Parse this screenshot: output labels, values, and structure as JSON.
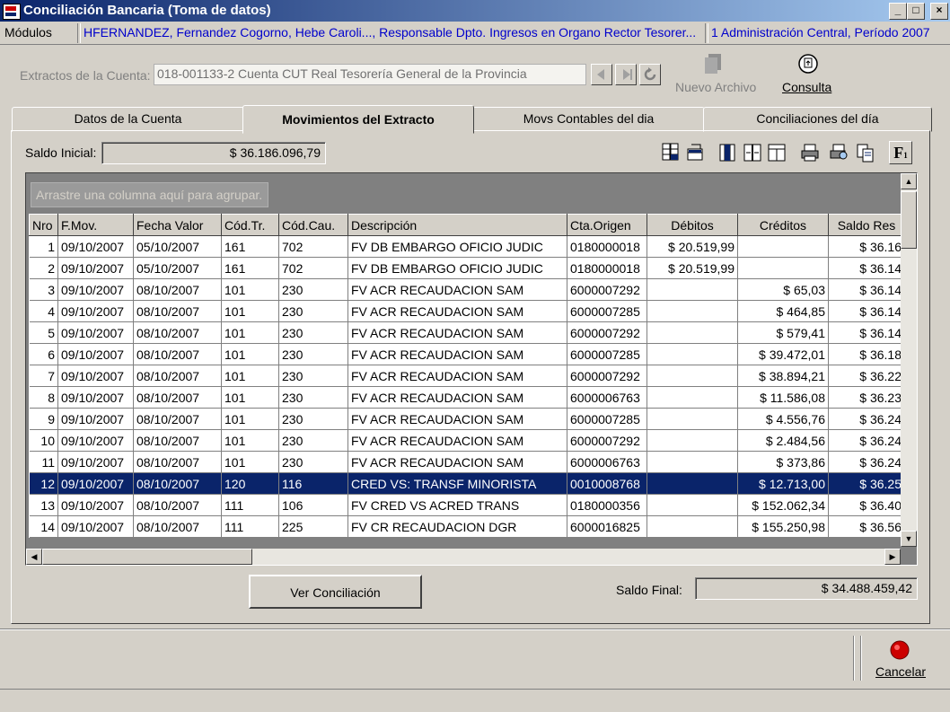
{
  "window": {
    "title": "Conciliación Bancaria (Toma de datos)",
    "controls": [
      "_",
      "□",
      "×"
    ]
  },
  "infobar": {
    "modules_label": "Módulos",
    "user_info": "HFERNANDEZ, Fernandez Cogorno, Hebe Caroli..., Responsable Dpto. Ingresos en Organo Rector Tesorer...",
    "org_info": "1 Administración Central, Período 2007"
  },
  "extract": {
    "label": "Extractos de la Cuenta:",
    "value": "018-001133-2 Cuenta CUT Real Tesorería General de la Provincia",
    "new_file_label": "Nuevo Archivo",
    "query_label": "Consulta"
  },
  "tabs": [
    "Datos de la Cuenta",
    "Movimientos del Extracto",
    "Movs Contables del dia",
    "Conciliaciones del día"
  ],
  "saldo_inicial": {
    "label": "Saldo Inicial:",
    "value": "$ 36.186.096,79"
  },
  "toolbar_icons": [
    "grid-layout-icon",
    "export-icon",
    "columns-icon",
    "split-icon",
    "filter-icon",
    "print-icon",
    "print-preview-icon",
    "copy-icon",
    "font-icon"
  ],
  "toolbar_font_glyph": "F",
  "group_hint": "Arrastre una columna aquí para agrupar.",
  "grid": {
    "columns": [
      "Nro",
      "F.Mov.",
      "Fecha Valor",
      "Cód.Tr.",
      "Cód.Cau.",
      "Descripción",
      "Cta.Origen",
      "Débitos",
      "Créditos",
      "Saldo Res"
    ],
    "rows": [
      [
        "1",
        "09/10/2007",
        "05/10/2007",
        "161",
        "702",
        "FV DB EMBARGO OFICIO JUDIC",
        "0180000018",
        "$ 20.519,99",
        "",
        "$ 36.16"
      ],
      [
        "2",
        "09/10/2007",
        "05/10/2007",
        "161",
        "702",
        "FV DB EMBARGO OFICIO JUDIC",
        "0180000018",
        "$ 20.519,99",
        "",
        "$ 36.14"
      ],
      [
        "3",
        "09/10/2007",
        "08/10/2007",
        "101",
        "230",
        "FV ACR RECAUDACION SAM",
        "6000007292",
        "",
        "$ 65,03",
        "$ 36.14"
      ],
      [
        "4",
        "09/10/2007",
        "08/10/2007",
        "101",
        "230",
        "FV ACR RECAUDACION SAM",
        "6000007285",
        "",
        "$ 464,85",
        "$ 36.14"
      ],
      [
        "5",
        "09/10/2007",
        "08/10/2007",
        "101",
        "230",
        "FV ACR RECAUDACION SAM",
        "6000007292",
        "",
        "$ 579,41",
        "$ 36.14"
      ],
      [
        "6",
        "09/10/2007",
        "08/10/2007",
        "101",
        "230",
        "FV ACR RECAUDACION SAM",
        "6000007285",
        "",
        "$ 39.472,01",
        "$ 36.18"
      ],
      [
        "7",
        "09/10/2007",
        "08/10/2007",
        "101",
        "230",
        "FV ACR RECAUDACION SAM",
        "6000007292",
        "",
        "$ 38.894,21",
        "$ 36.22"
      ],
      [
        "8",
        "09/10/2007",
        "08/10/2007",
        "101",
        "230",
        "FV ACR RECAUDACION SAM",
        "6000006763",
        "",
        "$ 11.586,08",
        "$ 36.23"
      ],
      [
        "9",
        "09/10/2007",
        "08/10/2007",
        "101",
        "230",
        "FV ACR RECAUDACION SAM",
        "6000007285",
        "",
        "$ 4.556,76",
        "$ 36.24"
      ],
      [
        "10",
        "09/10/2007",
        "08/10/2007",
        "101",
        "230",
        "FV ACR RECAUDACION SAM",
        "6000007292",
        "",
        "$ 2.484,56",
        "$ 36.24"
      ],
      [
        "11",
        "09/10/2007",
        "08/10/2007",
        "101",
        "230",
        "FV ACR RECAUDACION SAM",
        "6000006763",
        "",
        "$ 373,86",
        "$ 36.24"
      ],
      [
        "12",
        "09/10/2007",
        "08/10/2007",
        "120",
        "116",
        "CRED VS: TRANSF MINORISTA",
        "0010008768",
        "",
        "$ 12.713,00",
        "$ 36.25"
      ],
      [
        "13",
        "09/10/2007",
        "08/10/2007",
        "111",
        "106",
        "FV CRED VS ACRED TRANS",
        "0180000356",
        "",
        "$ 152.062,34",
        "$ 36.40"
      ],
      [
        "14",
        "09/10/2007",
        "08/10/2007",
        "111",
        "225",
        "FV  CR RECAUDACION DGR",
        "6000016825",
        "",
        "$ 155.250,98",
        "$ 36.56"
      ]
    ]
  },
  "ver_conciliacion_label": "Ver Conciliación",
  "saldo_final": {
    "label": "Saldo Final:",
    "value": "$ 34.488.459,42"
  },
  "cancel_label": "Cancelar",
  "colors": {
    "title_start": "#0a246a",
    "title_end": "#a6caf0",
    "selection": "#0a246a",
    "link": "#0000cc",
    "cancel": "#cc0000"
  }
}
